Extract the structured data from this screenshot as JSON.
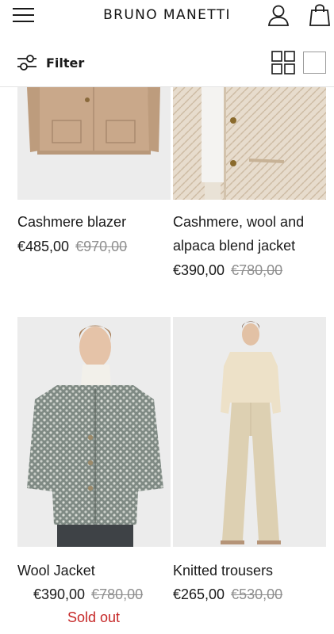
{
  "header": {
    "brand": "BRUNO MANETTI",
    "icons": [
      "menu-icon",
      "account-icon",
      "bag-icon"
    ]
  },
  "toolbar": {
    "filter_label": "Filter",
    "views": [
      "grid-four-icon",
      "grid-single-icon"
    ]
  },
  "products": [
    {
      "name": "Cashmere blazer",
      "price": "€485,00",
      "old_price": "€970,00"
    },
    {
      "name": "Cashmere, wool and alpaca blend jacket",
      "price": "€390,00",
      "old_price": "€780,00"
    },
    {
      "name": "Wool Jacket",
      "price": "€390,00",
      "old_price": "€780,00",
      "status": "Sold out"
    },
    {
      "name": "Knitted trousers",
      "price": "€265,00",
      "old_price": "€530,00"
    }
  ],
  "colors": {
    "text": "#1a1a1a",
    "strike": "#8e8e8e",
    "sold_out": "#c62828",
    "image_bg": "#ececec"
  }
}
